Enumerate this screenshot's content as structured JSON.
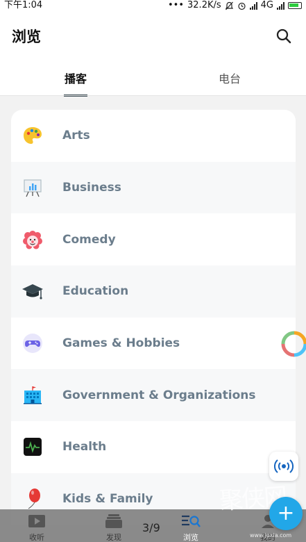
{
  "status_bar": {
    "time": "下午1:04",
    "dots": "•••",
    "speed": "32.2K/s",
    "network": "4G"
  },
  "header": {
    "title": "浏览",
    "search_icon": "search-icon"
  },
  "tabs": [
    {
      "label": "播客",
      "active": true
    },
    {
      "label": "电台",
      "active": false
    }
  ],
  "categories": [
    {
      "label": "Arts",
      "icon": "palette-icon"
    },
    {
      "label": "Business",
      "icon": "presentation-chart-icon"
    },
    {
      "label": "Comedy",
      "icon": "clown-face-icon"
    },
    {
      "label": "Education",
      "icon": "graduation-cap-icon"
    },
    {
      "label": "Games & Hobbies",
      "icon": "gamepad-icon"
    },
    {
      "label": "Government & Organizations",
      "icon": "government-building-icon"
    },
    {
      "label": "Health",
      "icon": "heartbeat-monitor-icon"
    },
    {
      "label": "Kids & Family",
      "icon": "balloon-icon"
    }
  ],
  "bottom_nav": {
    "items": [
      {
        "label": "收听",
        "icon": "play-video-icon"
      },
      {
        "label": "发现",
        "icon": "stack-cards-icon"
      },
      {
        "label": "浏览",
        "icon": "browse-search-icon",
        "active": true
      },
      {
        "label": "我的",
        "icon": "profile-icon"
      }
    ],
    "pager": "3/9"
  },
  "add_button_label": "+",
  "watermark": {
    "text": "聚侠网",
    "url": "www.juxia.com"
  },
  "colors": {
    "accent": "#22a7e8",
    "label": "#6b7d8c",
    "tab_underline": "#37474f"
  }
}
